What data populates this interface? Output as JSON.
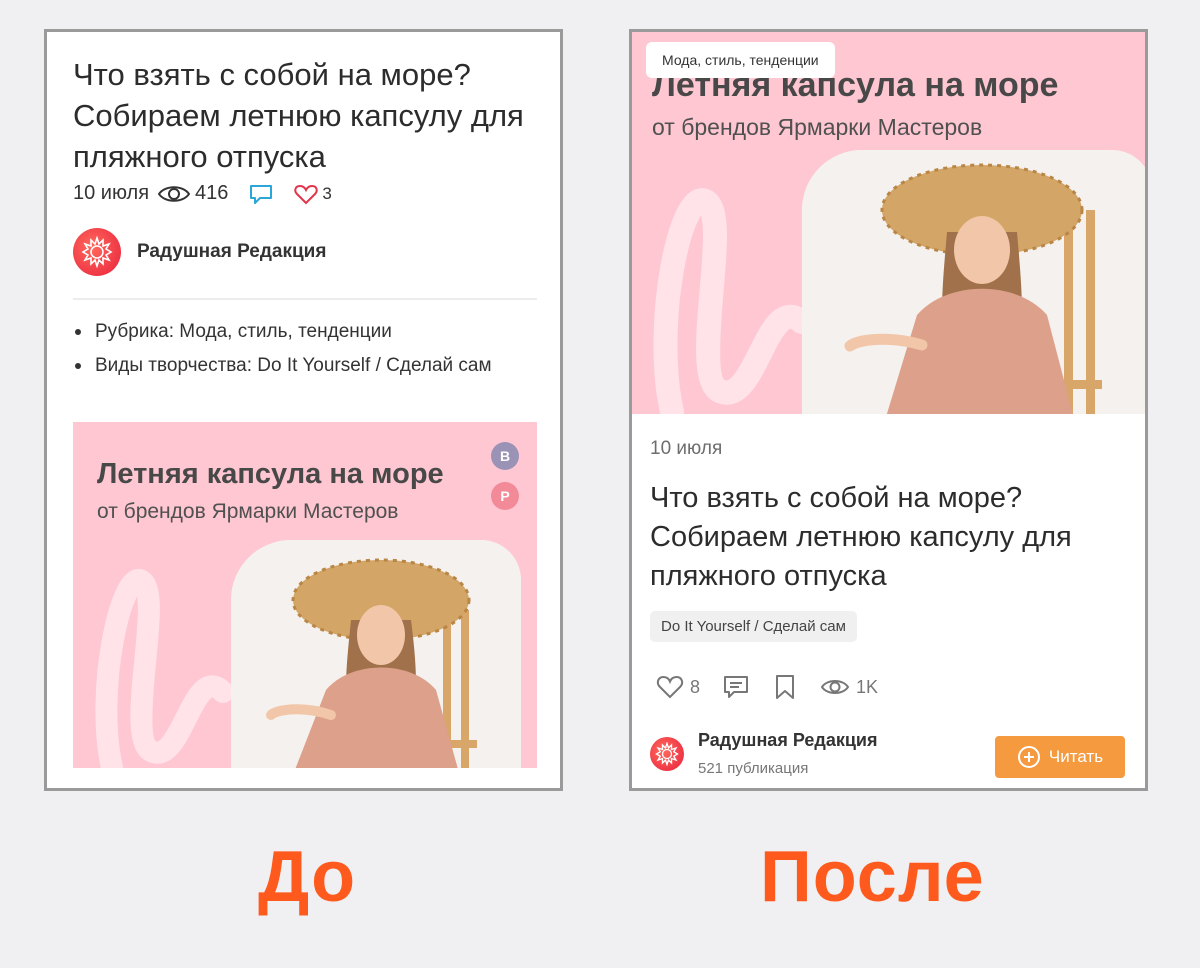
{
  "before": {
    "title": "Что взять с собой на море? Собираем летнюю капсулу для пляжного отпуска",
    "date": "10 июля",
    "views": "416",
    "likes": "3",
    "author": "Радушная Редакция",
    "list": [
      "Рубрика: Мода, стиль, тенденции",
      "Виды творчества: Do It Yourself / Сделай сам"
    ],
    "banner_title": "Летняя капсула на море",
    "banner_subtitle": "от брендов Ярмарки Мастеров",
    "share_vk": "В",
    "share_pinterest": "P",
    "caption": "До"
  },
  "after": {
    "chip": "Мода, стиль, тенденции",
    "banner_title": "Летняя капсула на море",
    "banner_subtitle": "от брендов Ярмарки Мастеров",
    "date": "10 июля",
    "title": "Что взять с собой на море? Собираем летнюю капсулу для пляжного отпуска",
    "tag": "Do It Yourself / Сделай сам",
    "likes": "8",
    "views": "1K",
    "author": "Радушная Редакция",
    "publications": "521 публикация",
    "read_button": "Читать",
    "caption": "После"
  },
  "colors": {
    "accent_orange": "#ff5a1d",
    "button_orange": "#f59a3f",
    "banner_pink": "#fec7d2",
    "like_red": "#e2344a",
    "comment_blue": "#2aa7d8"
  },
  "icons": [
    "eye-icon",
    "comment-icon",
    "heart-icon",
    "bookmark-icon",
    "plus-circle-icon",
    "avatar-sun-icon"
  ]
}
